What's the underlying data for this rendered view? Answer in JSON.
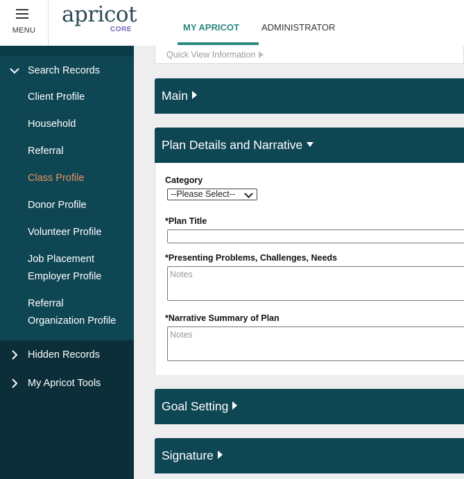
{
  "header": {
    "menu_label": "MENU",
    "logo_text": "apricot",
    "logo_sub": "CORE",
    "tabs": [
      {
        "label": "MY APRICOT",
        "active": true
      },
      {
        "label": "ADMINISTRATOR",
        "active": false
      }
    ]
  },
  "sidebar": {
    "search_records": "Search Records",
    "items": [
      {
        "label": "Client Profile"
      },
      {
        "label": "Household"
      },
      {
        "label": "Referral"
      },
      {
        "label": "Class Profile",
        "active": true
      },
      {
        "label": "Donor Profile"
      },
      {
        "label": "Volunteer Profile"
      },
      {
        "label_line1": "Job Placement",
        "label_line2": "Employer Profile"
      },
      {
        "label_line1": "Referral",
        "label_line2": "Organization Profile"
      }
    ],
    "hidden_records": "Hidden Records",
    "my_tools": "My Apricot Tools"
  },
  "main": {
    "quick_view": "Quick View Information",
    "sections": {
      "main": "Main",
      "plan": "Plan Details and Narrative",
      "goal": "Goal Setting",
      "signature": "Signature"
    },
    "form": {
      "category_label": "Category",
      "category_value": "--Please Select--",
      "plan_title_label": "*Plan Title",
      "plan_title_value": "",
      "problems_label": "*Presenting Problems, Challenges, Needs",
      "problems_placeholder": "Notes",
      "narrative_label": "*Narrative Summary of Plan",
      "narrative_placeholder": "Notes"
    }
  },
  "colors": {
    "sidebar_bg": "#0f4654",
    "sidebar_active": "#e8935e",
    "accent": "#2b8a7f",
    "logo_sub": "#7367b8"
  }
}
